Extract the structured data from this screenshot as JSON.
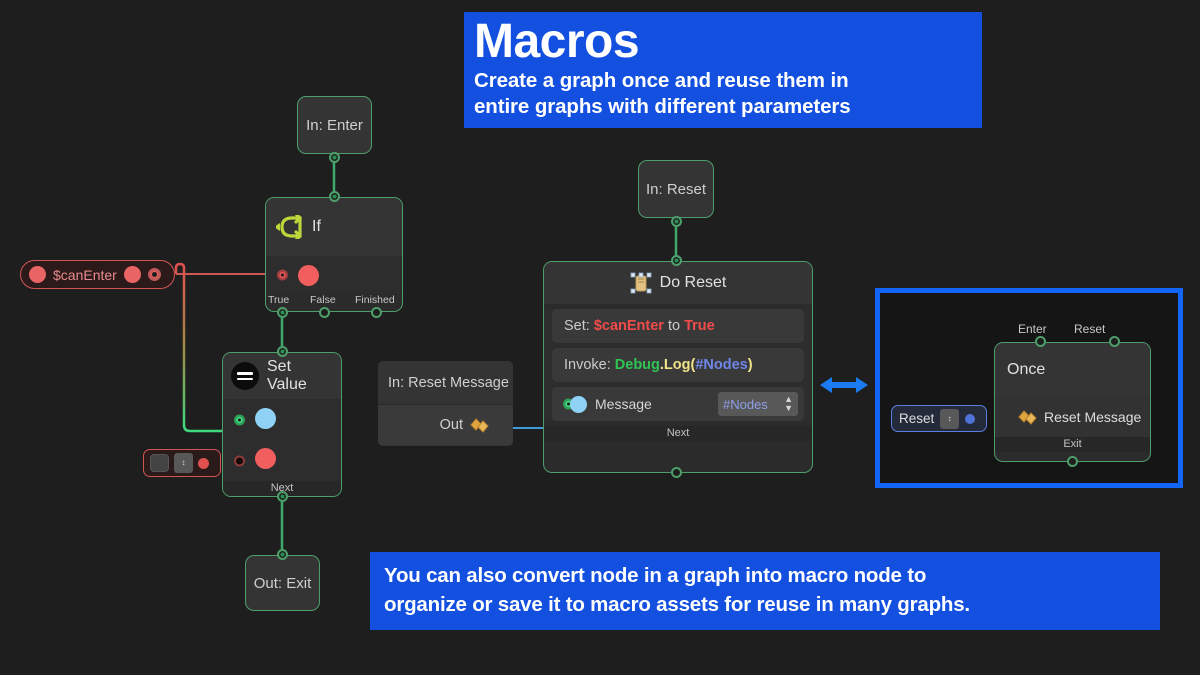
{
  "banners": {
    "top": {
      "title": "Macros",
      "subtitle_line1": "Create a graph once and reuse them in",
      "subtitle_line2": "entire graphs with different parameters",
      "color": "#1450e0"
    },
    "bottom": {
      "line1": "You can also convert node in a graph into macro node to",
      "line2": "organize or save it to macro assets for reuse in many graphs.",
      "color": "#1450e0"
    }
  },
  "graph": {
    "nodes": {
      "in_enter": {
        "label": "In: Enter"
      },
      "if_node": {
        "title": "If",
        "icon": "branch-arrow-icon",
        "outputs": [
          "True",
          "False",
          "Finished"
        ]
      },
      "set_value": {
        "title": "Set Value",
        "icon": "equals-icon",
        "footer": "Next"
      },
      "out_exit": {
        "label": "Out: Exit"
      },
      "in_reset": {
        "label": "In: Reset"
      },
      "in_reset_message": {
        "label": "In: Reset Message",
        "out_label": "Out",
        "out_icon": "gold-shapes-icon"
      },
      "do_reset": {
        "title": "Do Reset",
        "icon": "do-reset-icon",
        "statement_set": {
          "prefix": "Set: ",
          "variable": "$canEnter",
          "middle": " to ",
          "value": "True"
        },
        "statement_invoke": {
          "prefix": "Invoke: ",
          "target": "Debug",
          "dot": ".",
          "method": "Log",
          "open": "(",
          "argument": "#Nodes",
          "close": ")"
        },
        "message_row": {
          "label": "Message",
          "dropdown_value": "#Nodes"
        },
        "footer": "Next"
      }
    },
    "variables": {
      "can_enter": {
        "name": "$canEnter"
      }
    },
    "bool_widget": {
      "checkbox": "",
      "stepper": "↕"
    }
  },
  "macro": {
    "panel_border_color": "#1166f5",
    "node": {
      "title": "Once",
      "inputs": [
        "Enter",
        "Reset"
      ],
      "param_row": {
        "label": "Reset Message",
        "icon": "gold-shapes-icon"
      },
      "footer": "Exit"
    },
    "reset_widget": {
      "label": "Reset",
      "stepper": "↕"
    }
  },
  "arrow": {
    "name": "double-headed-arrow",
    "color": "#1166f5"
  }
}
